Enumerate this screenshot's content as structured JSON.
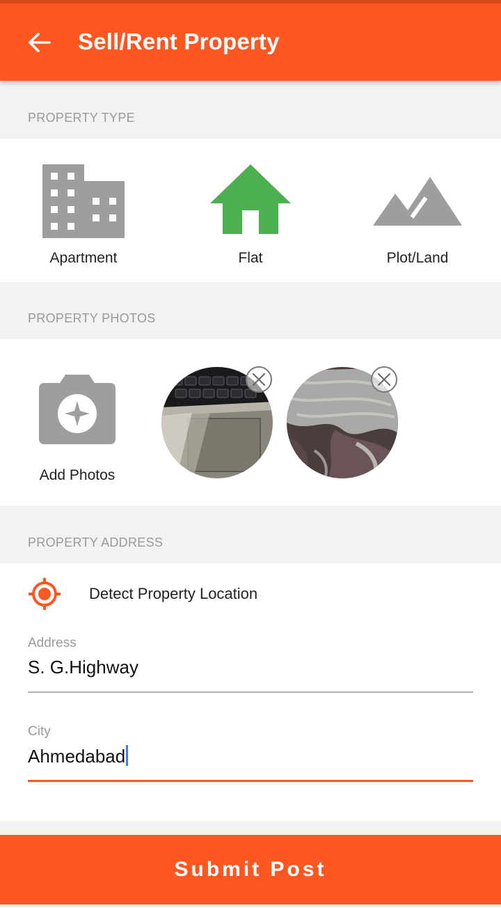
{
  "app_bar": {
    "title": "Sell/Rent Property",
    "back_icon": "arrow-left-icon",
    "color": "#ff5722"
  },
  "property_type": {
    "header": "PROPERTY TYPE",
    "options": [
      {
        "label": "Apartment",
        "icon": "building-icon",
        "selected": false
      },
      {
        "label": "Flat",
        "icon": "home-icon",
        "selected": true
      },
      {
        "label": "Plot/Land",
        "icon": "landscape-icon",
        "selected": false
      }
    ],
    "selected_color": "#4caf50",
    "unselected_color": "#9e9e9e"
  },
  "property_photos": {
    "header": "PROPERTY PHOTOS",
    "add_label": "Add Photos",
    "add_icon": "camera-icon",
    "photos": [
      {
        "subject": "laptop keyboard and trackpad",
        "remove_icon": "close-circle-icon"
      },
      {
        "subject": "patterned fabric",
        "remove_icon": "close-circle-icon"
      }
    ]
  },
  "property_address": {
    "header": "PROPERTY ADDRESS",
    "detect_label": "Detect Property Location",
    "detect_icon": "gps-target-icon",
    "address": {
      "label": "Address",
      "value": "S. G.Highway"
    },
    "city": {
      "label": "City",
      "value": "Ahmedabad",
      "focused": true
    }
  },
  "submit": {
    "label": "Submit Post"
  },
  "colors": {
    "accent": "#ff5722",
    "section_bg": "#f2f2f2",
    "muted_text": "#9a9a9a",
    "cursor": "#3f7fe0"
  }
}
